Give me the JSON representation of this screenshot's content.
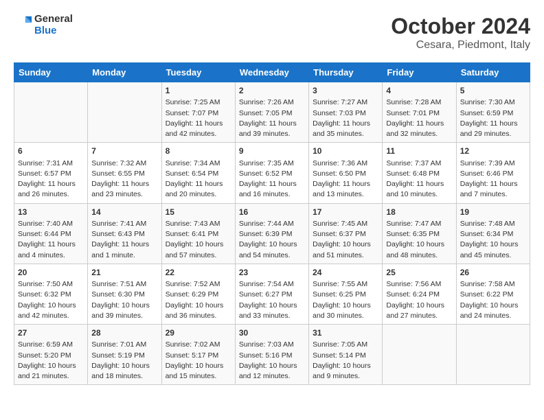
{
  "header": {
    "logo": {
      "line1": "General",
      "line2": "Blue"
    },
    "title": "October 2024",
    "subtitle": "Cesara, Piedmont, Italy"
  },
  "days_of_week": [
    "Sunday",
    "Monday",
    "Tuesday",
    "Wednesday",
    "Thursday",
    "Friday",
    "Saturday"
  ],
  "weeks": [
    [
      {
        "day": "",
        "sunrise": "",
        "sunset": "",
        "daylight": ""
      },
      {
        "day": "",
        "sunrise": "",
        "sunset": "",
        "daylight": ""
      },
      {
        "day": "1",
        "sunrise": "Sunrise: 7:25 AM",
        "sunset": "Sunset: 7:07 PM",
        "daylight": "Daylight: 11 hours and 42 minutes."
      },
      {
        "day": "2",
        "sunrise": "Sunrise: 7:26 AM",
        "sunset": "Sunset: 7:05 PM",
        "daylight": "Daylight: 11 hours and 39 minutes."
      },
      {
        "day": "3",
        "sunrise": "Sunrise: 7:27 AM",
        "sunset": "Sunset: 7:03 PM",
        "daylight": "Daylight: 11 hours and 35 minutes."
      },
      {
        "day": "4",
        "sunrise": "Sunrise: 7:28 AM",
        "sunset": "Sunset: 7:01 PM",
        "daylight": "Daylight: 11 hours and 32 minutes."
      },
      {
        "day": "5",
        "sunrise": "Sunrise: 7:30 AM",
        "sunset": "Sunset: 6:59 PM",
        "daylight": "Daylight: 11 hours and 29 minutes."
      }
    ],
    [
      {
        "day": "6",
        "sunrise": "Sunrise: 7:31 AM",
        "sunset": "Sunset: 6:57 PM",
        "daylight": "Daylight: 11 hours and 26 minutes."
      },
      {
        "day": "7",
        "sunrise": "Sunrise: 7:32 AM",
        "sunset": "Sunset: 6:55 PM",
        "daylight": "Daylight: 11 hours and 23 minutes."
      },
      {
        "day": "8",
        "sunrise": "Sunrise: 7:34 AM",
        "sunset": "Sunset: 6:54 PM",
        "daylight": "Daylight: 11 hours and 20 minutes."
      },
      {
        "day": "9",
        "sunrise": "Sunrise: 7:35 AM",
        "sunset": "Sunset: 6:52 PM",
        "daylight": "Daylight: 11 hours and 16 minutes."
      },
      {
        "day": "10",
        "sunrise": "Sunrise: 7:36 AM",
        "sunset": "Sunset: 6:50 PM",
        "daylight": "Daylight: 11 hours and 13 minutes."
      },
      {
        "day": "11",
        "sunrise": "Sunrise: 7:37 AM",
        "sunset": "Sunset: 6:48 PM",
        "daylight": "Daylight: 11 hours and 10 minutes."
      },
      {
        "day": "12",
        "sunrise": "Sunrise: 7:39 AM",
        "sunset": "Sunset: 6:46 PM",
        "daylight": "Daylight: 11 hours and 7 minutes."
      }
    ],
    [
      {
        "day": "13",
        "sunrise": "Sunrise: 7:40 AM",
        "sunset": "Sunset: 6:44 PM",
        "daylight": "Daylight: 11 hours and 4 minutes."
      },
      {
        "day": "14",
        "sunrise": "Sunrise: 7:41 AM",
        "sunset": "Sunset: 6:43 PM",
        "daylight": "Daylight: 11 hours and 1 minute."
      },
      {
        "day": "15",
        "sunrise": "Sunrise: 7:43 AM",
        "sunset": "Sunset: 6:41 PM",
        "daylight": "Daylight: 10 hours and 57 minutes."
      },
      {
        "day": "16",
        "sunrise": "Sunrise: 7:44 AM",
        "sunset": "Sunset: 6:39 PM",
        "daylight": "Daylight: 10 hours and 54 minutes."
      },
      {
        "day": "17",
        "sunrise": "Sunrise: 7:45 AM",
        "sunset": "Sunset: 6:37 PM",
        "daylight": "Daylight: 10 hours and 51 minutes."
      },
      {
        "day": "18",
        "sunrise": "Sunrise: 7:47 AM",
        "sunset": "Sunset: 6:35 PM",
        "daylight": "Daylight: 10 hours and 48 minutes."
      },
      {
        "day": "19",
        "sunrise": "Sunrise: 7:48 AM",
        "sunset": "Sunset: 6:34 PM",
        "daylight": "Daylight: 10 hours and 45 minutes."
      }
    ],
    [
      {
        "day": "20",
        "sunrise": "Sunrise: 7:50 AM",
        "sunset": "Sunset: 6:32 PM",
        "daylight": "Daylight: 10 hours and 42 minutes."
      },
      {
        "day": "21",
        "sunrise": "Sunrise: 7:51 AM",
        "sunset": "Sunset: 6:30 PM",
        "daylight": "Daylight: 10 hours and 39 minutes."
      },
      {
        "day": "22",
        "sunrise": "Sunrise: 7:52 AM",
        "sunset": "Sunset: 6:29 PM",
        "daylight": "Daylight: 10 hours and 36 minutes."
      },
      {
        "day": "23",
        "sunrise": "Sunrise: 7:54 AM",
        "sunset": "Sunset: 6:27 PM",
        "daylight": "Daylight: 10 hours and 33 minutes."
      },
      {
        "day": "24",
        "sunrise": "Sunrise: 7:55 AM",
        "sunset": "Sunset: 6:25 PM",
        "daylight": "Daylight: 10 hours and 30 minutes."
      },
      {
        "day": "25",
        "sunrise": "Sunrise: 7:56 AM",
        "sunset": "Sunset: 6:24 PM",
        "daylight": "Daylight: 10 hours and 27 minutes."
      },
      {
        "day": "26",
        "sunrise": "Sunrise: 7:58 AM",
        "sunset": "Sunset: 6:22 PM",
        "daylight": "Daylight: 10 hours and 24 minutes."
      }
    ],
    [
      {
        "day": "27",
        "sunrise": "Sunrise: 6:59 AM",
        "sunset": "Sunset: 5:20 PM",
        "daylight": "Daylight: 10 hours and 21 minutes."
      },
      {
        "day": "28",
        "sunrise": "Sunrise: 7:01 AM",
        "sunset": "Sunset: 5:19 PM",
        "daylight": "Daylight: 10 hours and 18 minutes."
      },
      {
        "day": "29",
        "sunrise": "Sunrise: 7:02 AM",
        "sunset": "Sunset: 5:17 PM",
        "daylight": "Daylight: 10 hours and 15 minutes."
      },
      {
        "day": "30",
        "sunrise": "Sunrise: 7:03 AM",
        "sunset": "Sunset: 5:16 PM",
        "daylight": "Daylight: 10 hours and 12 minutes."
      },
      {
        "day": "31",
        "sunrise": "Sunrise: 7:05 AM",
        "sunset": "Sunset: 5:14 PM",
        "daylight": "Daylight: 10 hours and 9 minutes."
      },
      {
        "day": "",
        "sunrise": "",
        "sunset": "",
        "daylight": ""
      },
      {
        "day": "",
        "sunrise": "",
        "sunset": "",
        "daylight": ""
      }
    ]
  ]
}
